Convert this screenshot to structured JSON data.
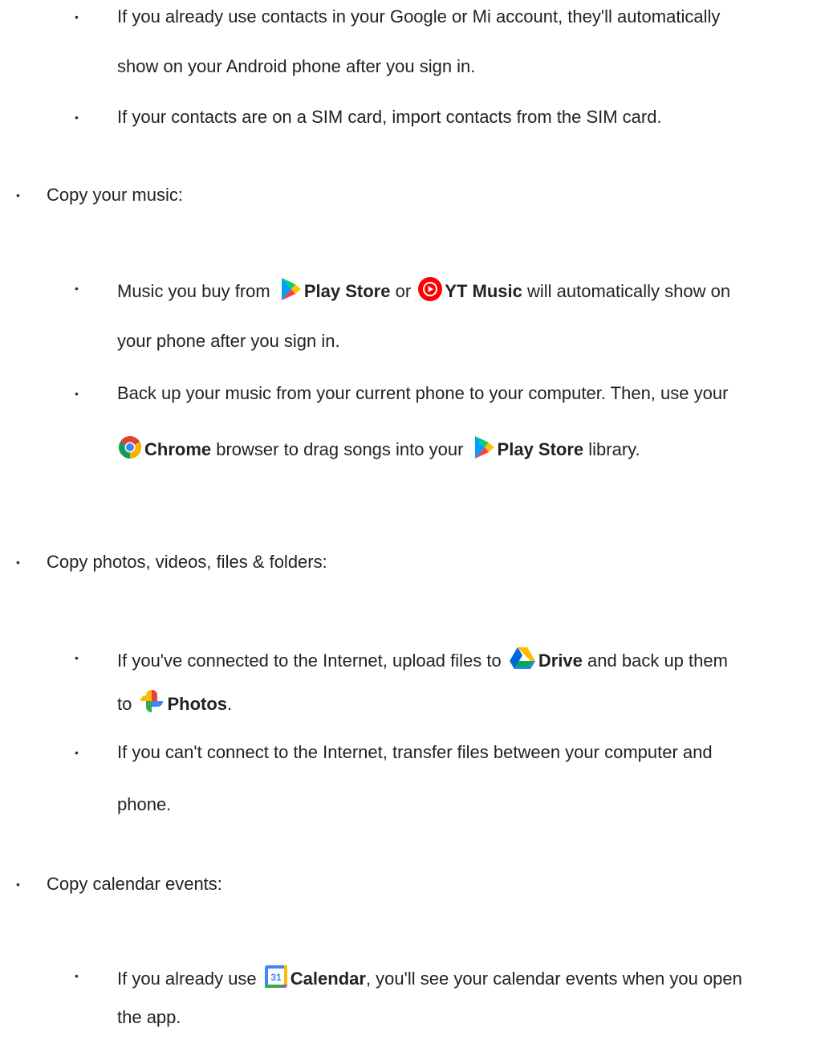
{
  "contacts": {
    "item_google": "If you already use contacts in your Google or Mi account, they'll automatically",
    "item_google_cont": "show on your Android phone after you sign in.",
    "item_sim": "If your contacts are on a SIM card, import contacts from the SIM card."
  },
  "music": {
    "heading": "Copy your music:",
    "buy_prefix": "Music you buy from",
    "play_store": "Play Store",
    "or": "or",
    "yt_music": "YT Music",
    "buy_suffix": "will automatically show on",
    "buy_cont": "your phone after you sign in.",
    "backup_line": "Back up your music from your current phone to your computer. Then, use your",
    "chrome": "Chrome",
    "drag_text": "browser to drag songs into your",
    "play_store_2": "Play Store",
    "library": "library."
  },
  "photos": {
    "heading": "Copy photos, videos, files & folders:",
    "connected_prefix": "If you've connected to the Internet, upload files to",
    "drive": "Drive",
    "connected_suffix": "and back up them",
    "to": "to",
    "photos": "Photos",
    "period": ".",
    "offline": "If you can't connect to the Internet, transfer files between your computer and",
    "offline_cont": "phone."
  },
  "calendar": {
    "heading": "Copy calendar events:",
    "prefix": "If you already use",
    "calendar": "Calendar",
    "suffix": ", you'll see your calendar events when you open",
    "cont": "the app.",
    "icon_day": "31"
  },
  "bullet_char": "•",
  "icons": [
    "play-store-icon",
    "yt-music-icon",
    "chrome-icon",
    "drive-icon",
    "photos-icon",
    "calendar-icon"
  ]
}
